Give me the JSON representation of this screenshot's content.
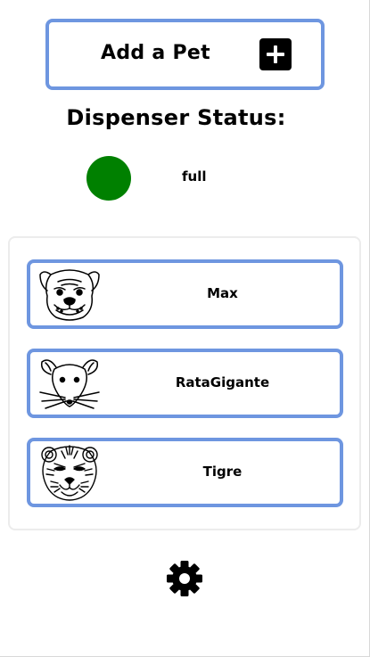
{
  "add_pet": {
    "label": "Add a Pet",
    "icon": "plus-square-icon"
  },
  "dispenser": {
    "title": "Dispenser Status:",
    "status": "full",
    "status_color": "#008000"
  },
  "pets": [
    {
      "name": "Max",
      "icon": "bulldog-icon"
    },
    {
      "name": "RataGigante",
      "icon": "rat-icon"
    },
    {
      "name": "Tigre",
      "icon": "tiger-icon"
    }
  ],
  "colors": {
    "accent_border": "#6e96e0",
    "panel_border": "#ececec"
  },
  "footer": {
    "icon": "gear-icon"
  }
}
